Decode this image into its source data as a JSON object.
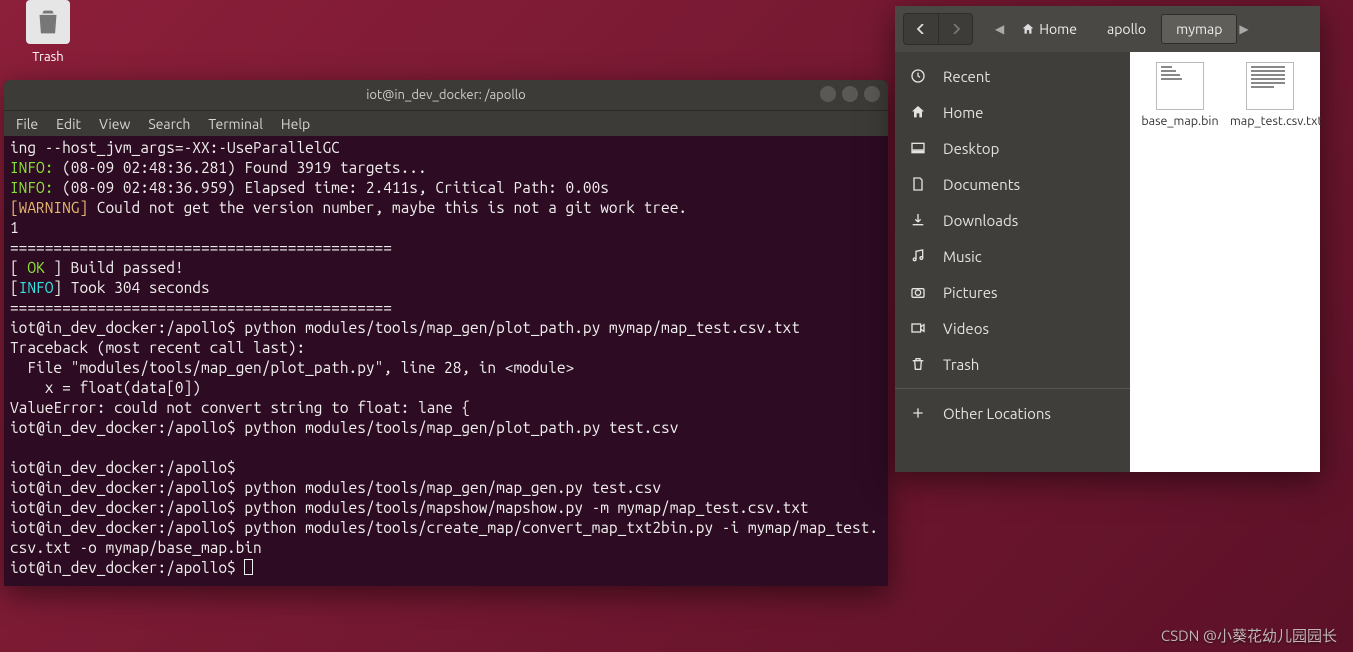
{
  "desktop": {
    "trash_label": "Trash"
  },
  "terminal": {
    "title": "iot@in_dev_docker: /apollo",
    "menu": {
      "file": "File",
      "edit": "Edit",
      "view": "View",
      "search": "Search",
      "terminal": "Terminal",
      "help": "Help"
    },
    "lines": {
      "l0": "ing --host_jvm_args=-XX:-UseParallelGC",
      "info1_pre": "INFO:",
      "info1_rest": " (08-09 02:48:36.281) Found 3919 targets...",
      "info2_pre": "INFO:",
      "info2_rest": " (08-09 02:48:36.959) Elapsed time: 2.411s, Critical Path: 0.00s",
      "warn_pre": "[WARNING]",
      "warn_rest": " Could not get the version number, maybe this is not a git work tree.",
      "one": "1",
      "sep": "============================================",
      "ok_l": "[ ",
      "ok_mid": "OK",
      "ok_r": " ] Build passed!",
      "info3_l": "[",
      "info3_mid": "INFO",
      "info3_r": "] Took 304 seconds",
      "prompt1": "iot@in_dev_docker:/apollo$ ",
      "cmd1": "python modules/tools/map_gen/plot_path.py mymap/map_test.csv.txt",
      "tb1": "Traceback (most recent call last):",
      "tb2": "  File \"modules/tools/map_gen/plot_path.py\", line 28, in <module>",
      "tb3": "    x = float(data[0])",
      "tb4": "ValueError: could not convert string to float: lane {",
      "cmd2": "python modules/tools/map_gen/plot_path.py test.csv",
      "cmd3": "python modules/tools/map_gen/map_gen.py test.csv",
      "cmd4": "python modules/tools/mapshow/mapshow.py -m mymap/map_test.csv.txt",
      "cmd5": "python modules/tools/create_map/convert_map_txt2bin.py -i mymap/map_test.csv.txt -o mymap/base_map.bin"
    }
  },
  "files": {
    "path": {
      "home": "Home",
      "p1": "apollo",
      "p2": "mymap"
    },
    "sidebar": {
      "recent": "Recent",
      "home": "Home",
      "desktop": "Desktop",
      "documents": "Documents",
      "downloads": "Downloads",
      "music": "Music",
      "pictures": "Pictures",
      "videos": "Videos",
      "trash": "Trash",
      "other": "Other Locations"
    },
    "items": {
      "f1": "base_map.bin",
      "f2": "map_test.csv.txt"
    }
  },
  "watermark": "CSDN @小葵花幼儿园园长"
}
